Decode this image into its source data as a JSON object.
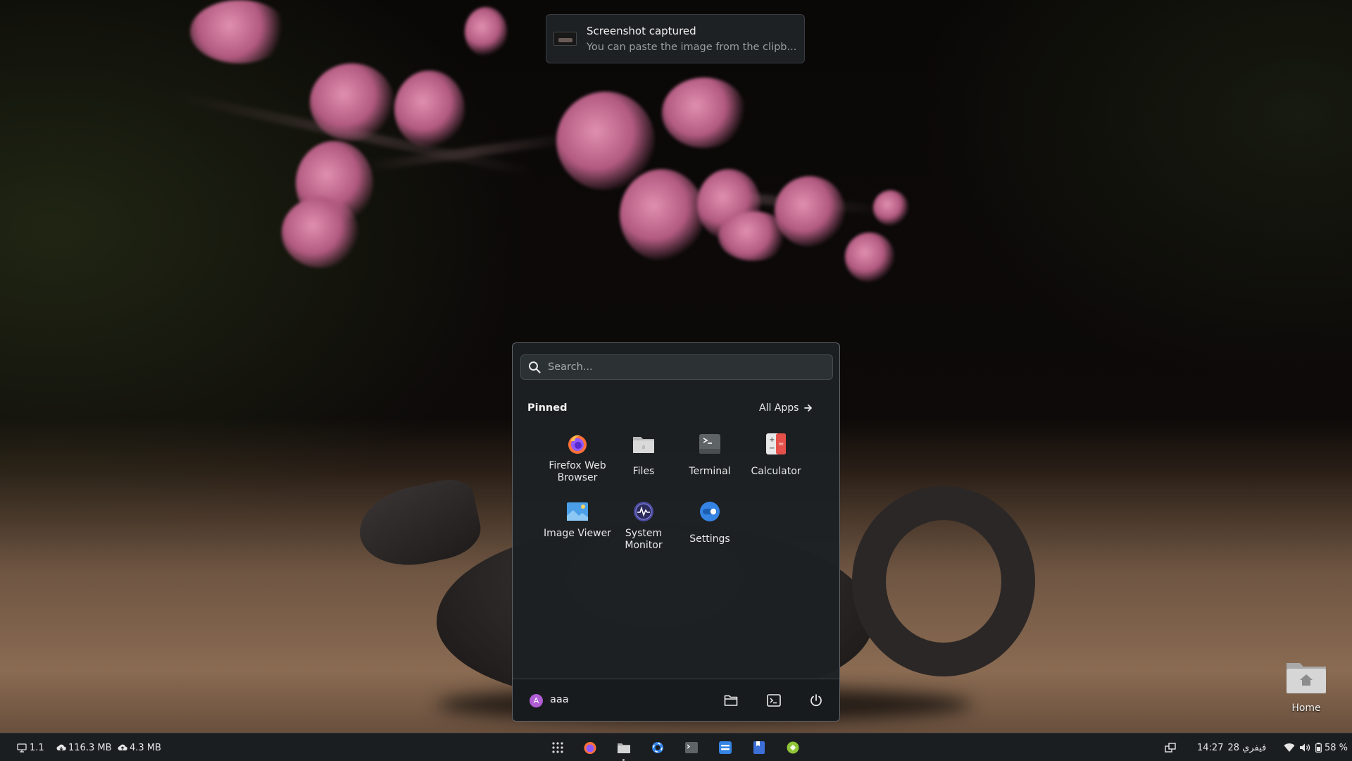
{
  "notification": {
    "title": "Screenshot captured",
    "body": "You can paste the image from the clipb..."
  },
  "menu": {
    "search_placeholder": "Search...",
    "pinned_label": "Pinned",
    "all_apps_label": "All Apps",
    "apps": [
      {
        "label": "Firefox Web Browser",
        "icon": "firefox-icon"
      },
      {
        "label": "Files",
        "icon": "files-icon"
      },
      {
        "label": "Terminal",
        "icon": "terminal-icon"
      },
      {
        "label": "Calculator",
        "icon": "calculator-icon"
      },
      {
        "label": "Image Viewer",
        "icon": "image-viewer-icon"
      },
      {
        "label": "System Monitor",
        "icon": "system-monitor-icon"
      },
      {
        "label": "Settings",
        "icon": "settings-icon"
      }
    ],
    "user": {
      "avatar_letter": "A",
      "name": "aaa"
    }
  },
  "desktop": {
    "home_label": "Home"
  },
  "taskbar": {
    "workspace": "1.1",
    "download_speed": "116.3 MB",
    "upload_speed": "4.3 MB",
    "time": "14:27",
    "date": "28 فيفري",
    "battery": "58 %"
  },
  "colors": {
    "accent": "#3584e4",
    "avatar": "#b15ed6",
    "panel_bg": "#1c2023"
  }
}
